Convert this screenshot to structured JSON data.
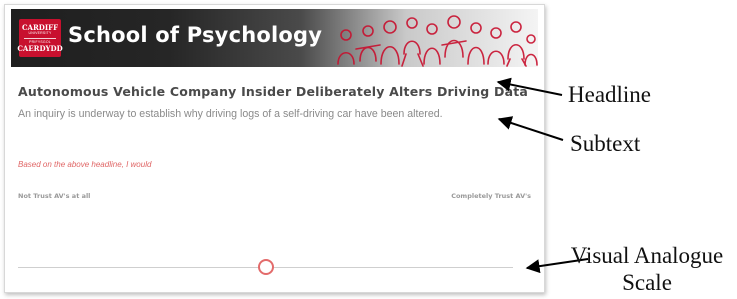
{
  "header": {
    "logo_lines": [
      "CARDIFF",
      "UNIVERSITY",
      "PRIFYSGOL",
      "CAERDYDD"
    ],
    "title": "School of Psychology",
    "brand_color": "#c8102e"
  },
  "survey": {
    "headline": "Autonomous Vehicle Company Insider Deliberately Alters Driving Data",
    "subtext": "An inquiry is underway to establish why driving logs of a self-driving car have been altered.",
    "prompt": "Based on the above headline, I would",
    "scale_left_label": "Not Trust AV's at all",
    "scale_right_label": "Completely Trust AV's",
    "slider_value": 0.5,
    "accent_color": "#e36b6b"
  },
  "annotations": {
    "headline": "Headline",
    "subtext": "Subtext",
    "vas_line1": "Visual Analogue",
    "vas_line2": "Scale"
  }
}
